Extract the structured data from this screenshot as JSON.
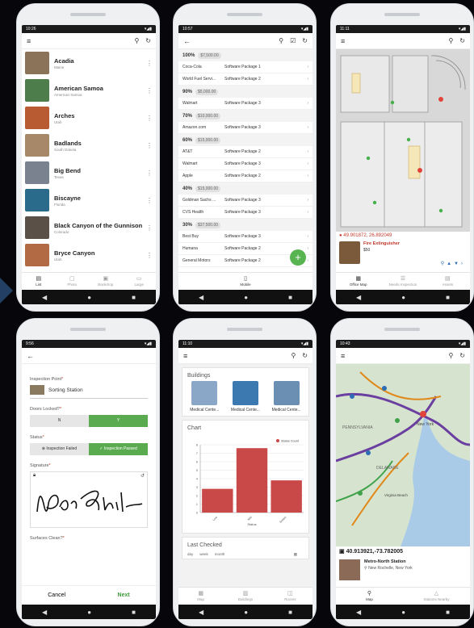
{
  "phone1": {
    "time": "10:26",
    "status_icons": "▾◢▮",
    "parks": [
      {
        "name": "Acadia",
        "state": "Maine",
        "color": "#8a7358"
      },
      {
        "name": "American Samoa",
        "state": "American Samoa",
        "color": "#4d7d4a"
      },
      {
        "name": "Arches",
        "state": "Utah",
        "color": "#b85a32"
      },
      {
        "name": "Badlands",
        "state": "South Dakota",
        "color": "#a7896a"
      },
      {
        "name": "Big Bend",
        "state": "Texas",
        "color": "#7a8290"
      },
      {
        "name": "Biscayne",
        "state": "Florida",
        "color": "#2a6a8a"
      },
      {
        "name": "Black Canyon of the Gunnison",
        "state": "Colorado",
        "color": "#5a5048"
      },
      {
        "name": "Bryce Canyon",
        "state": "Utah",
        "color": "#b26a45"
      }
    ],
    "tabs": [
      "List",
      "Photo",
      "Backdrop",
      "Large"
    ]
  },
  "phone2": {
    "time": "10:57",
    "rows": [
      {
        "type": "group",
        "pct": "100%",
        "amt": "$7,500.00"
      },
      {
        "type": "row",
        "c1": "Coca-Cola",
        "c2": "Software Package 1"
      },
      {
        "type": "row",
        "c1": "World Fuel Servi...",
        "c2": "Software Package 2"
      },
      {
        "type": "group",
        "pct": "90%",
        "amt": "$5,000.00"
      },
      {
        "type": "row",
        "c1": "Walmart",
        "c2": "Software Package 3"
      },
      {
        "type": "group",
        "pct": "70%",
        "amt": "$10,000.00"
      },
      {
        "type": "row",
        "c1": "Amazon.com",
        "c2": "Software Package 3"
      },
      {
        "type": "group",
        "pct": "60%",
        "amt": "$15,000.00"
      },
      {
        "type": "row",
        "c1": "AT&T",
        "c2": "Software Package 2"
      },
      {
        "type": "row",
        "c1": "Walmart",
        "c2": "Software Package 3"
      },
      {
        "type": "row",
        "c1": "Apple",
        "c2": "Software Package 2"
      },
      {
        "type": "group",
        "pct": "40%",
        "amt": "$15,000.00"
      },
      {
        "type": "row",
        "c1": "Goldman Sachs ...",
        "c2": "Software Package 3"
      },
      {
        "type": "row",
        "c1": "CVS Health",
        "c2": "Software Package 3"
      },
      {
        "type": "group",
        "pct": "30%",
        "amt": "$37,500.00"
      },
      {
        "type": "row",
        "c1": "Best Buy",
        "c2": "Software Package 3"
      },
      {
        "type": "row",
        "c1": "Humana",
        "c2": "Software Package 2"
      },
      {
        "type": "row",
        "c1": "General Motors",
        "c2": "Software Package 2"
      }
    ],
    "tab": "Mobile",
    "fab": "+"
  },
  "phone3": {
    "time": "11:11",
    "coords": "49.901872, 26.892049",
    "asset_title": "Fire Extinguisher",
    "asset_price": "$50",
    "tabs": [
      "Office Map",
      "Needs Inspection",
      "Assets"
    ]
  },
  "phone4": {
    "time": "9:56",
    "inspection_label": "Inspection Point",
    "inspection_value": "Sorting Station",
    "doors_label": "Doors Locked?",
    "doors_options": [
      "N",
      "Y"
    ],
    "status_label": "Status",
    "status_options": [
      "Inspection Failed",
      "Inspection Passed"
    ],
    "signature_label": "Signature",
    "surfaces_label": "Surfaces Clean?",
    "cancel": "Cancel",
    "next": "Next"
  },
  "phone5": {
    "time": "11:10",
    "buildings_title": "Buildings",
    "buildings": [
      {
        "name": "Medical Cente...",
        "color": "#8aa7c7"
      },
      {
        "name": "Medical Cente...",
        "color": "#3b79b0"
      },
      {
        "name": "Medical Cente...",
        "color": "#6b8fb3"
      }
    ],
    "chart_title": "Chart",
    "last_title": "Last Checked",
    "last_filters": [
      "day",
      "week",
      "month"
    ],
    "tabs": [
      "Map",
      "Buildings",
      "Rooms"
    ]
  },
  "chart_data": {
    "type": "bar",
    "categories": [
      "Low",
      "Mid",
      "Sixties"
    ],
    "values": [
      2.8,
      7.6,
      3.8
    ],
    "legend": [
      "Status Count"
    ],
    "xlabel": "Status",
    "ylim": [
      0,
      8
    ],
    "yticks": [
      "0",
      "1",
      "2",
      "3",
      "4",
      "5",
      "6",
      "7",
      "8"
    ],
    "bar_color": "#c94848",
    "legend_position": "top-right"
  },
  "phone6": {
    "time": "10:43",
    "coords": "40.913921,-73.782005",
    "station": "Metro-North Station",
    "place": "New Rochelle, New York",
    "tabs": [
      "Map",
      "Stations Nearby"
    ],
    "map_labels": [
      "PENNSYLVANIA",
      "New York",
      "DELAWARE",
      "Virginia Beach"
    ]
  }
}
